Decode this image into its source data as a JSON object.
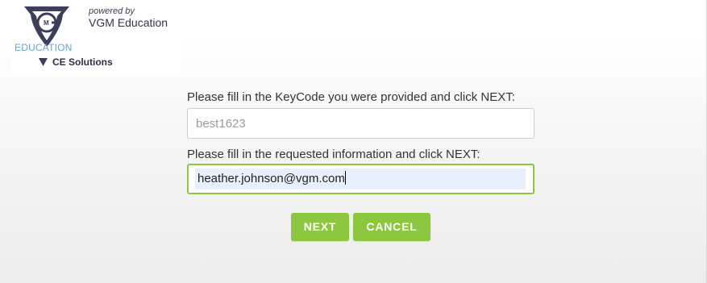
{
  "logo": {
    "tagline": "powered by",
    "company": "VGM Education",
    "education": "EDUCATION",
    "ce_solutions": "CE Solutions",
    "icon": "vgm-shield-icon"
  },
  "form": {
    "keycode_label": "Please fill in the KeyCode you were provided and click NEXT:",
    "keycode_value": "best1623",
    "info_label": "Please fill in the requested information and click NEXT:",
    "info_value": "heather.johnson@vgm.com",
    "next_label": "NEXT",
    "cancel_label": "CANCEL"
  },
  "colors": {
    "accent": "#8dc63f",
    "autofill": "#e8f0fe",
    "education_blue": "#5fa7c8"
  }
}
